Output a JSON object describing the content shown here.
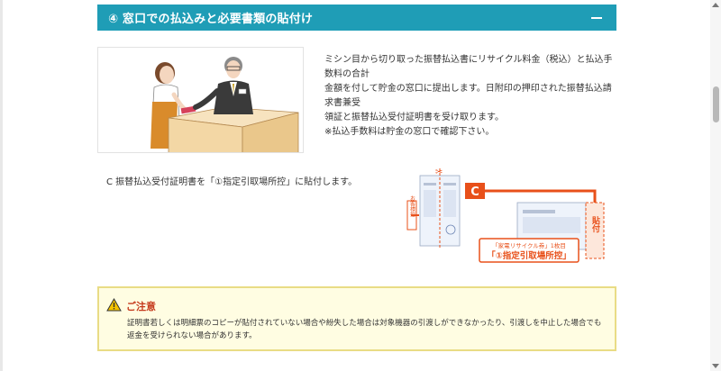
{
  "section": {
    "title": "④ 窓口での払込みと必要書類の貼付け",
    "collapse_icon": "minus-icon"
  },
  "description": {
    "line1": "ミシン目から切り取った振替払込書にリサイクル料金（税込）と払込手数料の合計",
    "line2": "金額を付して貯金の窓口に提出します。日附印の押印された振替払込請求書兼受",
    "line3": "領証と振替払込受付証明書を受け取ります。",
    "line4": "※払込手数料は貯金の窓口で確認下さい。"
  },
  "step_c": {
    "text": "C  振替払込受付証明書を「①指定引取場所控」に貼付します。"
  },
  "diagram": {
    "badge": "C",
    "stamp_label": "貼付",
    "side_label": "お客様控",
    "caption_small": "「家電リサイクル券」1枚目",
    "caption_large": "「①指定引取場所控」",
    "icons": [
      "scissors-icon",
      "arrow-right-icon",
      "arrow-left-icon"
    ],
    "accent": "#e8501a"
  },
  "notice": {
    "title": "ご注意",
    "icon": "warning-icon",
    "text": "証明書若しくは明細票のコピーが貼付されていない場合や紛失した場合は対象機器の引渡しができなかったり、引渡しを中止した場合でも返金を受けられない場合があります。",
    "background": "#fffde2",
    "border": "#e9dc85"
  },
  "colors": {
    "header": "#1f9db6",
    "orange": "#e8501a",
    "warning": "#c53a1c"
  }
}
